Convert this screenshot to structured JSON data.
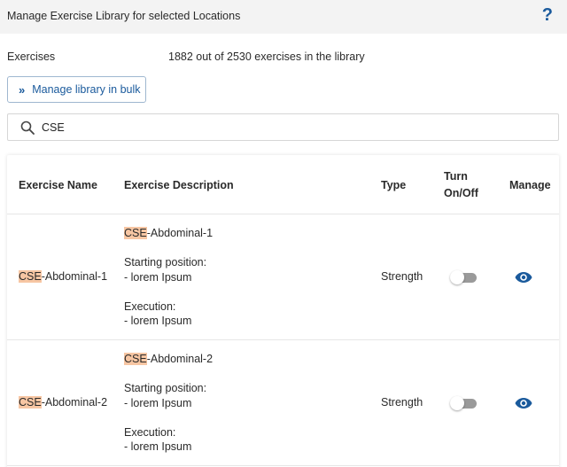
{
  "header": {
    "title": "Manage Exercise Library for selected Locations",
    "help_label": "?"
  },
  "stats": {
    "label": "Exercises",
    "value": "1882 out of 2530 exercises in the library"
  },
  "bulk_button": {
    "label": "Manage library in bulk",
    "icon": "double-chevron-right-icon"
  },
  "search": {
    "value": "CSE",
    "icon": "search-icon"
  },
  "table": {
    "columns": {
      "name": "Exercise Name",
      "description": "Exercise Description",
      "type": "Type",
      "turn_line1": "Turn",
      "turn_line2": "On/Off",
      "manage": "Manage"
    },
    "rows": [
      {
        "name_match": "CSE",
        "name_rest": "-Abdominal-1",
        "desc_match": "CSE",
        "desc_title_rest": "-Abdominal-1",
        "starting_label": "Starting position:",
        "starting_text": "- lorem Ipsum",
        "execution_label": "Execution:",
        "execution_text": "- lorem Ipsum",
        "type": "Strength",
        "enabled": false
      },
      {
        "name_match": "CSE",
        "name_rest": "-Abdominal-2",
        "desc_match": "CSE",
        "desc_title_rest": "-Abdominal-2",
        "starting_label": "Starting position:",
        "starting_text": "- lorem Ipsum",
        "execution_label": "Execution:",
        "execution_text": "- lorem Ipsum",
        "type": "Strength",
        "enabled": false
      }
    ]
  },
  "colors": {
    "accent": "#1a5a9c",
    "highlight": "#f7c6a3",
    "header_bg": "#f3f3f3",
    "toggle_off": "#9a9a9a"
  }
}
